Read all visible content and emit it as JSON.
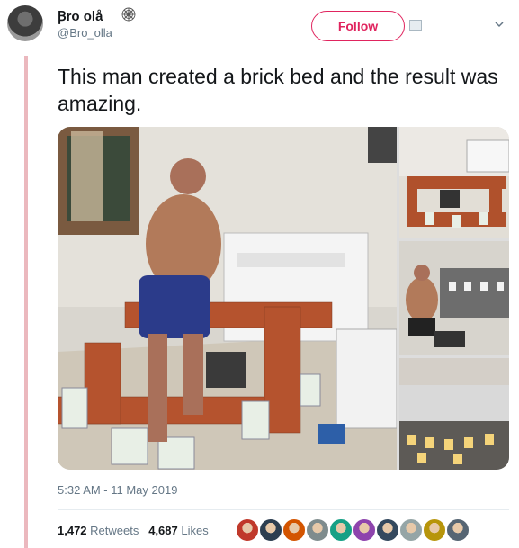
{
  "author": {
    "name": "Ꞵro olå",
    "handle": "@Bro_olla",
    "icon": "spiderweb-icon"
  },
  "follow_button": {
    "label": "Follow"
  },
  "tweet": {
    "text": "This man created a brick bed and the result was amazing."
  },
  "media": {
    "images": [
      "main-photo-man-building-brick-bed",
      "brick-frame-top-view",
      "man-working-on-bed",
      "finished-bed-lit"
    ]
  },
  "timestamp": "5:32 AM - 11 May 2019",
  "stats": {
    "retweets_count": "1,472",
    "retweets_label": "Retweets",
    "likes_count": "4,687",
    "likes_label": "Likes"
  },
  "colors": {
    "accent": "#e0245e",
    "thread_line": "#ebb8be",
    "muted_text": "#657786"
  },
  "likers": [
    "#c0392b",
    "#2c3e50",
    "#d35400",
    "#7f8c8d",
    "#16a085",
    "#8e44ad",
    "#34495e",
    "#95a5a6",
    "#b7950b",
    "#566573"
  ]
}
